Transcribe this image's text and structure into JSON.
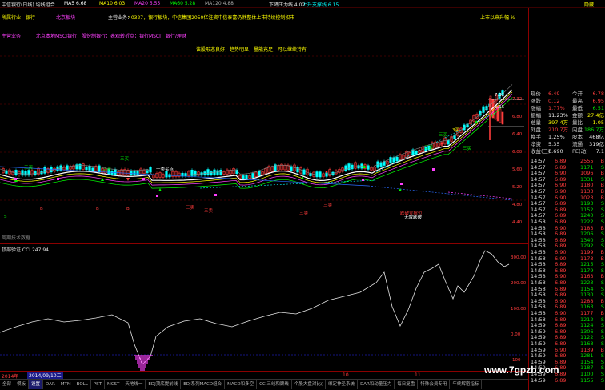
{
  "title_bar": {
    "stock_name": "中信银行(日线) 均线组合",
    "ma_items": [
      {
        "label": "MA5",
        "value": "6.68",
        "color": "#ffffff"
      },
      {
        "label": "MA10",
        "value": "6.03",
        "color": "#ffff00"
      },
      {
        "label": "MA20",
        "value": "5.55",
        "color": "#ff40ff"
      },
      {
        "label": "MA60",
        "value": "5.28",
        "color": "#00ff00"
      },
      {
        "label": "MA120",
        "value": "4.88",
        "color": "#aaaaaa"
      }
    ],
    "pressure": "下降压力线 4.02",
    "support": "上升支撑线 6.15",
    "corner": "隐藏"
  },
  "info_bar": {
    "industry": "所属行业：银行",
    "concept": "北京板块",
    "main_business_label": "主营业务：",
    "main_business": "40327，银行板块，中信集团2050亿注资中信泰富仍然整体上市持续控制权市",
    "listing": "上市以来升幅 %",
    "row2": "主营业务：",
    "row2_text": "北京本地MSCI银行；股份制银行；表观转折点；银行MSCI；银行/理财",
    "status_msg": "该股形态良好，趋势明显，量能充足，可以继续持有"
  },
  "main_chart": {
    "price_labels": [
      {
        "text": "7.32"
      },
      {
        "text": "6.80"
      },
      {
        "text": "6.40"
      },
      {
        "text": "6.00"
      },
      {
        "text": "5.60"
      },
      {
        "text": "5.20"
      },
      {
        "text": "4.80"
      },
      {
        "text": "4.40"
      }
    ],
    "annotations": [
      {
        "text": "三买",
        "color": "#00ff00"
      },
      {
        "text": "三买",
        "color": "#00ff00"
      },
      {
        "text": "三买",
        "color": "#00ff00"
      },
      {
        "text": "一类买点",
        "color": "#ffffff"
      },
      {
        "text": "三卖",
        "color": "#ff3c3c"
      },
      {
        "text": "三卖",
        "color": "#ff3c3c"
      },
      {
        "text": "三卖",
        "color": "#ff3c3c"
      },
      {
        "text": "三卖",
        "color": "#ff3c3c"
      },
      {
        "text": "三买",
        "color": "#00ff00"
      },
      {
        "text": "三买",
        "color": "#00ff00"
      },
      {
        "text": "3买",
        "color": "#ffff00"
      },
      {
        "text": "三买",
        "color": "#00ff00"
      },
      {
        "text": "7.32",
        "color": "#ffffff"
      },
      {
        "text": "6.15",
        "color": "#ffffff"
      },
      {
        "text": "跌破支撑位",
        "color": "#ff3c3c"
      },
      {
        "text": "无效跌破",
        "color": "#ffffff"
      },
      {
        "text": "B",
        "color": "#ff3c3c"
      },
      {
        "text": "B",
        "color": "#ff3c3c"
      },
      {
        "text": "B",
        "color": "#ff3c3c"
      },
      {
        "text": "S",
        "color": "#00ff00"
      }
    ],
    "bottom_note": "周期技术数据"
  },
  "indicator": {
    "title": "顶部验证 CCI 247.94",
    "scale": [
      {
        "text": "300.00"
      },
      {
        "text": "200.00"
      },
      {
        "text": "100.00"
      },
      {
        "text": "0.00"
      },
      {
        "text": "-100"
      }
    ]
  },
  "timeline": {
    "items": [
      "2014年",
      "2014/09/10二",
      "10",
      "11"
    ]
  },
  "tabs": [
    {
      "label": "全部",
      "active": false
    },
    {
      "label": "模板",
      "active": false
    },
    {
      "label": "设置",
      "active": true
    },
    {
      "label": "DAR",
      "active": false
    },
    {
      "label": "MTM",
      "active": false
    },
    {
      "label": "BOLL",
      "active": false
    },
    {
      "label": "PST",
      "active": false
    },
    {
      "label": "MCST",
      "active": false
    },
    {
      "label": "天地线一",
      "active": false
    },
    {
      "label": "EDJ顶底提前线",
      "active": false
    },
    {
      "label": "EDJ系列MACD组合",
      "active": false
    },
    {
      "label": "MACD和多空",
      "active": false
    },
    {
      "label": "CCI三线和顾线",
      "active": false
    },
    {
      "label": "个股大盘对比(",
      "active": false
    },
    {
      "label": "绑定神圣系统",
      "active": false
    },
    {
      "label": "DAR和动量压力",
      "active": false
    },
    {
      "label": "每日复盘",
      "active": false
    },
    {
      "label": "特殊会员专用",
      "active": false
    },
    {
      "label": "年终解密指标",
      "active": false
    }
  ],
  "quote": [
    {
      "l1": "现价",
      "v1": "6.49",
      "l2": "今开",
      "v2": "6.78",
      "c1": "#ff3c3c",
      "c2": "#ff3c3c"
    },
    {
      "l1": "涨跌",
      "v1": "0.12",
      "l2": "最高",
      "v2": "6.95",
      "c1": "#ff3c3c",
      "c2": "#ff3c3c"
    },
    {
      "l1": "涨幅",
      "v1": "1.77%",
      "l2": "最低",
      "v2": "6.51",
      "c1": "#ff3c3c",
      "c2": "#00e000"
    },
    {
      "l1": "振幅",
      "v1": "11.23%",
      "l2": "金额",
      "v2": "27.4亿",
      "c1": "#e6e6e6",
      "c2": "#ffff00"
    },
    {
      "l1": "总量",
      "v1": "397.4万",
      "l2": "量比",
      "v2": "1.05",
      "c1": "#ffff00",
      "c2": "#ffff00"
    },
    {
      "l1": "外盘",
      "v1": "210.7万",
      "l2": "内盘",
      "v2": "186.7万",
      "c1": "#ff3c3c",
      "c2": "#00e000"
    },
    {
      "l1": "换手",
      "v1": "1.25%",
      "l2": "股本",
      "v2": "468亿",
      "c1": "#e6e6e6",
      "c2": "#e6e6e6"
    },
    {
      "l1": "净资",
      "v1": "5.35",
      "l2": "流通",
      "v2": "319亿",
      "c1": "#e6e6e6",
      "c2": "#e6e6e6"
    },
    {
      "l1": "收益(三)",
      "v1": "0.690",
      "l2": "PE(动)",
      "v2": "7.1",
      "c1": "#e6e6e6",
      "c2": "#e6e6e6"
    }
  ],
  "ticks": [
    {
      "t": "14:57",
      "p": "6.89",
      "v": "2555",
      "d": "B"
    },
    {
      "t": "14:57",
      "p": "6.89",
      "v": "1171",
      "d": "S"
    },
    {
      "t": "14:57",
      "p": "6.90",
      "v": "1096",
      "d": "B"
    },
    {
      "t": "14:57",
      "p": "6.89",
      "v": "1331",
      "d": "S"
    },
    {
      "t": "14:57",
      "p": "6.90",
      "v": "1180",
      "d": "B"
    },
    {
      "t": "14:57",
      "p": "6.90",
      "v": "1133",
      "d": "B"
    },
    {
      "t": "14:57",
      "p": "6.90",
      "v": "1023",
      "d": "B"
    },
    {
      "t": "14:57",
      "p": "6.89",
      "v": "1193",
      "d": "S"
    },
    {
      "t": "14:57",
      "p": "6.89",
      "v": "1152",
      "d": "S"
    },
    {
      "t": "14:57",
      "p": "6.89",
      "v": "1240",
      "d": "S"
    },
    {
      "t": "14:58",
      "p": "6.89",
      "v": "1222",
      "d": "S"
    },
    {
      "t": "14:58",
      "p": "6.90",
      "v": "1183",
      "d": "B"
    },
    {
      "t": "14:58",
      "p": "6.89",
      "v": "1206",
      "d": "S"
    },
    {
      "t": "14:58",
      "p": "6.89",
      "v": "1340",
      "d": "S"
    },
    {
      "t": "14:58",
      "p": "6.89",
      "v": "1292",
      "d": "S"
    },
    {
      "t": "14:58",
      "p": "6.90",
      "v": "1199",
      "d": "B"
    },
    {
      "t": "14:58",
      "p": "6.90",
      "v": "1173",
      "d": "B"
    },
    {
      "t": "14:58",
      "p": "6.89",
      "v": "1215",
      "d": "S"
    },
    {
      "t": "14:58",
      "p": "6.89",
      "v": "1179",
      "d": "S"
    },
    {
      "t": "14:58",
      "p": "6.90",
      "v": "1163",
      "d": "B"
    },
    {
      "t": "14:58",
      "p": "6.89",
      "v": "1223",
      "d": "S"
    },
    {
      "t": "14:58",
      "p": "6.89",
      "v": "1154",
      "d": "S"
    },
    {
      "t": "14:58",
      "p": "6.89",
      "v": "1130",
      "d": "S"
    },
    {
      "t": "14:58",
      "p": "6.90",
      "v": "1288",
      "d": "B"
    },
    {
      "t": "14:58",
      "p": "6.89",
      "v": "1163",
      "d": "S"
    },
    {
      "t": "14:58",
      "p": "6.90",
      "v": "1177",
      "d": "B"
    },
    {
      "t": "14:58",
      "p": "6.89",
      "v": "1212",
      "d": "S"
    },
    {
      "t": "14:59",
      "p": "6.89",
      "v": "1124",
      "d": "S"
    },
    {
      "t": "14:59",
      "p": "6.89",
      "v": "1306",
      "d": "S"
    },
    {
      "t": "14:59",
      "p": "6.89",
      "v": "1122",
      "d": "S"
    },
    {
      "t": "14:59",
      "p": "6.89",
      "v": "1168",
      "d": "S"
    },
    {
      "t": "14:59",
      "p": "6.90",
      "v": "1139",
      "d": "B"
    },
    {
      "t": "14:59",
      "p": "6.89",
      "v": "1281",
      "d": "S"
    },
    {
      "t": "14:59",
      "p": "6.89",
      "v": "1154",
      "d": "S"
    },
    {
      "t": "14:59",
      "p": "6.89",
      "v": "1187",
      "d": "S"
    },
    {
      "t": "14:59",
      "p": "6.89",
      "v": "1100",
      "d": "S"
    },
    {
      "t": "14:59",
      "p": "6.89",
      "v": "1155",
      "d": "S"
    }
  ],
  "watermark": "www.7gpzb.com"
}
